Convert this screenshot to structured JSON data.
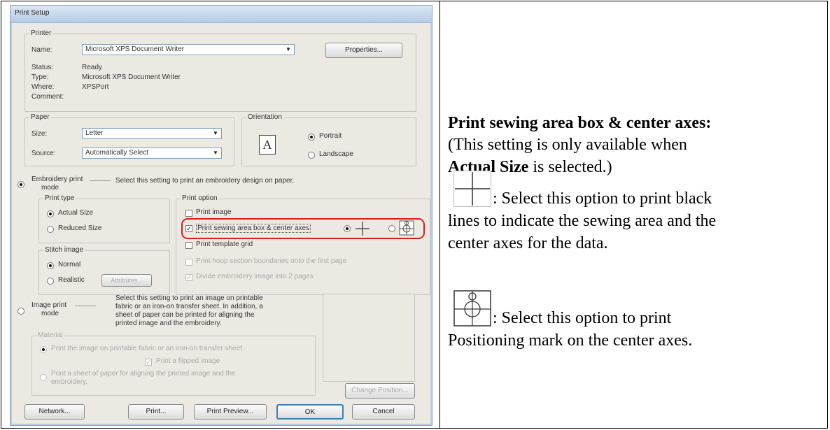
{
  "dialog": {
    "title": "Print Setup",
    "printer": {
      "group_label": "Printer",
      "name_label": "Name:",
      "name_value": "Microsoft XPS Document Writer",
      "properties_button": "Properties...",
      "status_label": "Status:",
      "status_value": "Ready",
      "type_label": "Type:",
      "type_value": "Microsoft XPS Document Writer",
      "where_label": "Where:",
      "where_value": "XPSPort",
      "comment_label": "Comment:"
    },
    "paper": {
      "group_label": "Paper",
      "size_label": "Size:",
      "size_value": "Letter",
      "source_label": "Source:",
      "source_value": "Automatically Select"
    },
    "orientation": {
      "group_label": "Orientation",
      "icon_letter": "A",
      "portrait": "Portrait",
      "landscape": "Landscape",
      "selected": "Portrait"
    },
    "embroidery_mode": {
      "label_line1": "Embroidery print",
      "label_line2": "mode",
      "description": "Select this setting to print an embroidery design on paper.",
      "selected": true
    },
    "print_type": {
      "group_label": "Print type",
      "actual_size": "Actual Size",
      "reduced_size": "Reduced Size",
      "selected": "Actual Size"
    },
    "stitch_image": {
      "group_label": "Stitch image",
      "normal": "Normal",
      "realistic": "Realistic",
      "attributes_button": "Attributes...",
      "selected": "Normal"
    },
    "print_option": {
      "group_label": "Print option",
      "print_image": "Print image",
      "print_sewing_area": "Print sewing area box & center axes",
      "print_template_grid": "Print template grid",
      "print_hoop_sections": "Print hoop section boundaries onto the first page",
      "divide_design": "Divide embroidery image into 2 pages",
      "print_image_checked": false,
      "print_sewing_area_checked": true,
      "print_template_grid_checked": false,
      "print_hoop_sections_checked": false,
      "divide_design_checked": true
    },
    "image_mode": {
      "label_line1": "Image print",
      "label_line2": "mode",
      "description_lines": [
        "Select this setting to print an image on printable",
        "fabric or an iron-on transfer sheet. In addition, a",
        "sheet of paper can be printed for aligning the",
        "printed image and the embroidery."
      ],
      "material_label": "Material",
      "material_opt1": "Print the image on printable fabric or an iron-on transfer sheet",
      "flipped_image": "Print a flipped image",
      "material_opt2_line1": "Print a sheet of paper for aligning the printed image and the",
      "material_opt2_line2": "embroidery.",
      "change_position_button": "Change Position..."
    },
    "buttons": {
      "network": "Network...",
      "print": "Print...",
      "print_preview": "Print Preview...",
      "ok": "OK",
      "cancel": "Cancel"
    }
  },
  "help": {
    "heading": "Print sewing area box & center axes:",
    "note_line1": "(This setting is only available when",
    "note_bold": "Actual Size",
    "note_rest": " is selected.)",
    "cross_line1": ": Select this option to print black",
    "cross_line2": "lines to indicate the sewing area and the",
    "cross_line3": "center axes for the data.",
    "mark_line1": ": Select this option to print",
    "mark_line2": "Positioning mark on the center axes."
  }
}
